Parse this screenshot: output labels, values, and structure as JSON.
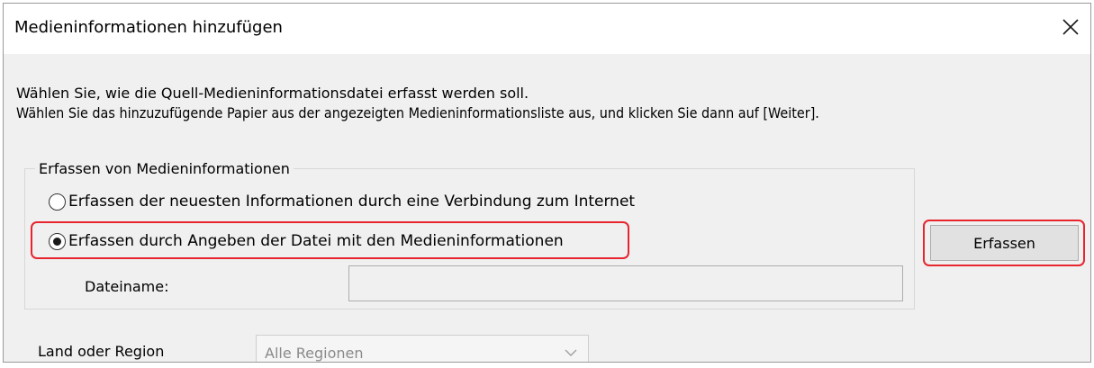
{
  "window": {
    "title": "Medieninformationen hinzufügen"
  },
  "instructions": {
    "line1": "Wählen Sie, wie die Quell-Medieninformationsdatei erfasst werden soll.",
    "line2": "Wählen Sie das hinzuzufügende Papier aus der angezeigten Medieninformationsliste aus, und klicken Sie dann auf [Weiter]."
  },
  "acquire_group": {
    "title": "Erfassen von Medieninformationen",
    "options": [
      {
        "label": "Erfassen der neuesten Informationen durch eine Verbindung zum Internet",
        "selected": false
      },
      {
        "label": "Erfassen durch Angeben der Datei mit den Medieninformationen",
        "selected": true
      }
    ],
    "filename_label": "Dateiname:",
    "filename_value": "",
    "acquire_button": "Erfassen"
  },
  "region": {
    "label": "Land oder Region",
    "selected": "Alle Regionen"
  },
  "colors": {
    "highlight": "#e8252f",
    "dialog_background": "#f0f0f0",
    "titlebar_background": "#ffffff"
  },
  "icons": {
    "close": "close-icon",
    "dropdown": "chevron-down-icon"
  }
}
